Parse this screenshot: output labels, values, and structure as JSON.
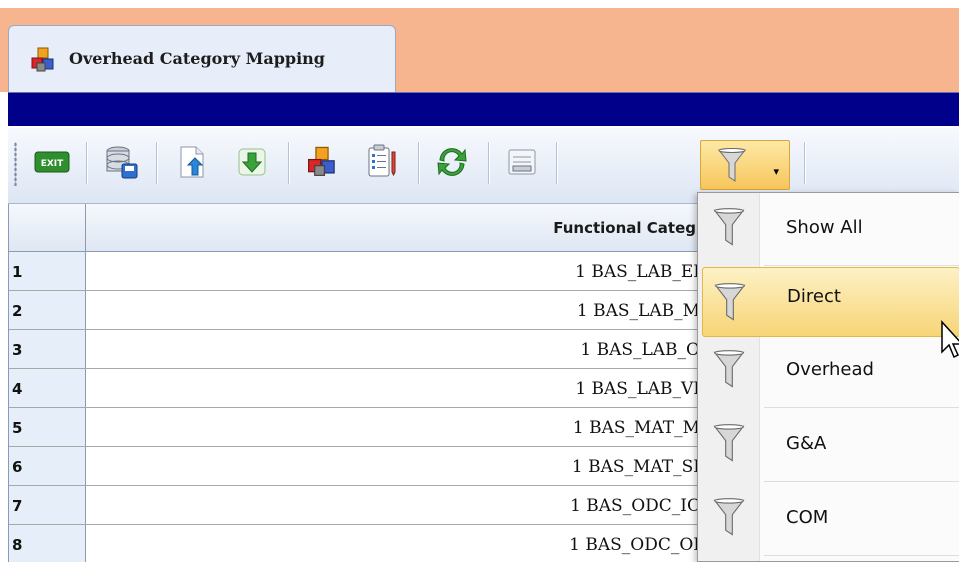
{
  "tab": {
    "title": "Overhead Category Mapping",
    "icon": "cubes-icon"
  },
  "toolbar": {
    "buttons": [
      {
        "name": "exit",
        "label": "EXIT",
        "icon": "exit-icon"
      },
      {
        "name": "save",
        "icon": "database-save-icon"
      },
      {
        "name": "export",
        "icon": "document-export-icon"
      },
      {
        "name": "download",
        "icon": "download-arrow-icon"
      },
      {
        "name": "categories",
        "icon": "cubes-icon"
      },
      {
        "name": "checklist",
        "icon": "checklist-icon"
      },
      {
        "name": "refresh",
        "icon": "refresh-icon"
      },
      {
        "name": "print",
        "icon": "printer-icon"
      }
    ],
    "filter_icon": "filter-funnel-icon"
  },
  "grid": {
    "column_header": "Functional Categ",
    "rows": [
      {
        "num": "1",
        "value": "1 BAS_LAB_EI"
      },
      {
        "num": "2",
        "value": "1 BAS_LAB_M"
      },
      {
        "num": "3",
        "value": "1 BAS_LAB_O"
      },
      {
        "num": "4",
        "value": "1 BAS_LAB_VI"
      },
      {
        "num": "5",
        "value": "1 BAS_MAT_M"
      },
      {
        "num": "6",
        "value": "1 BAS_MAT_SI"
      },
      {
        "num": "7",
        "value": "1 BAS_ODC_IC"
      },
      {
        "num": "8",
        "value": "1 BAS_ODC_OI"
      }
    ]
  },
  "filter_menu": {
    "items": [
      {
        "label": "Show All",
        "highlighted": false
      },
      {
        "label": "Direct",
        "highlighted": true
      },
      {
        "label": "Overhead",
        "highlighted": false
      },
      {
        "label": "G&A",
        "highlighted": false
      },
      {
        "label": "COM",
        "highlighted": false
      }
    ]
  },
  "colors": {
    "tab_strip": "#f6b48f",
    "navy_bar": "#00008b",
    "highlight": "#f7d577"
  }
}
